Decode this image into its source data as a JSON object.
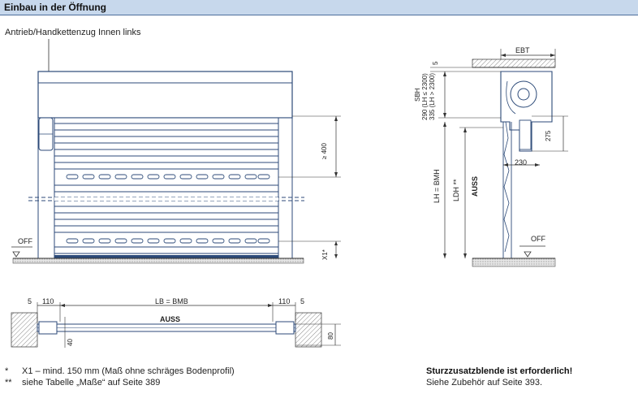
{
  "header": {
    "title": "Einbau in der Öffnung"
  },
  "front_view": {
    "drive_label": "Antrieb/Handkettenzug Innen links",
    "dim_400": "≥ 400",
    "dim_x1": "X1*",
    "off_label": "OFF"
  },
  "side_view": {
    "ebt": "EBT",
    "dim_5": "5",
    "sbh": "SBH",
    "sbh_290": "290 (LH ≤ 2300)",
    "sbh_335": "335 (LH > 2300)",
    "dim_275": "275",
    "dim_230": "230",
    "lh": "LH = BMH",
    "ldh": "LDH **",
    "auss": "AUSS",
    "off_label": "OFF"
  },
  "plan_view": {
    "dim_5_left": "5",
    "dim_110_left": "110",
    "lb": "LB = BMB",
    "dim_110_right": "110",
    "dim_5_right": "5",
    "auss": "AUSS",
    "dim_40": "40",
    "dim_80": "80"
  },
  "footnotes": {
    "n1_mark": "*",
    "n1_text": "X1 – mind. 150 mm (Maß ohne schräges Bodenprofil)",
    "n2_mark": "**",
    "n2_text": "siehe Tabelle „Maße“ auf Seite 389",
    "notice_bold": "Sturzzusatzblende ist erforderlich!",
    "notice_text": "Siehe Zubehör auf Seite 393."
  },
  "colors": {
    "header_bg": "#c7d8ec",
    "line": "#2c4a78",
    "hatch": "#9a9a9a"
  }
}
